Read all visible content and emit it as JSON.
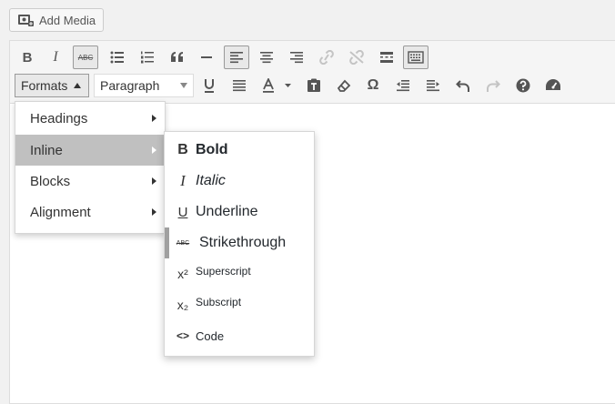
{
  "add_media": {
    "label": "Add Media",
    "icon": "media-camera-icon"
  },
  "toolbar_row1": [
    {
      "name": "bold-button",
      "icon": "B"
    },
    {
      "name": "italic-button",
      "icon": "I"
    },
    {
      "name": "strikethrough-button",
      "icon": "ABC",
      "active": true
    },
    {
      "name": "bulleted-list-button",
      "icon": "bullet-list-icon"
    },
    {
      "name": "numbered-list-button",
      "icon": "numbered-list-icon"
    },
    {
      "name": "blockquote-button",
      "icon": "quote-icon"
    },
    {
      "name": "horizontal-line-button",
      "icon": "dash-icon"
    },
    {
      "name": "align-left-button",
      "icon": "align-left-icon",
      "active": true
    },
    {
      "name": "align-center-button",
      "icon": "align-center-icon"
    },
    {
      "name": "align-right-button",
      "icon": "align-right-icon"
    },
    {
      "name": "insert-link-button",
      "icon": "link-icon",
      "disabled": true
    },
    {
      "name": "remove-link-button",
      "icon": "unlink-icon",
      "disabled": true
    },
    {
      "name": "read-more-button",
      "icon": "more-tag-icon"
    },
    {
      "name": "toolbar-toggle-button",
      "icon": "keyboard-icon",
      "active": true
    }
  ],
  "formats": {
    "label": "Formats"
  },
  "paragraph": {
    "value": "Paragraph"
  },
  "menu_level1": [
    {
      "label": "Headings"
    },
    {
      "label": "Inline",
      "selected": true
    },
    {
      "label": "Blocks"
    },
    {
      "label": "Alignment"
    }
  ],
  "menu_inline": [
    {
      "icon": "B",
      "label": "Bold"
    },
    {
      "icon": "I",
      "label": "Italic"
    },
    {
      "icon": "U",
      "label": "Underline"
    },
    {
      "icon": "ABC",
      "label": "Strikethrough"
    },
    {
      "icon": "x²",
      "label": "Superscript"
    },
    {
      "icon": "x₂",
      "label": "Subscript"
    },
    {
      "icon": "<>",
      "label": "Code"
    }
  ],
  "colors": {
    "menu_selected": "#c0c0c0",
    "toolbar_bg": "#f5f5f5",
    "editor_bg": "#ffffff"
  }
}
